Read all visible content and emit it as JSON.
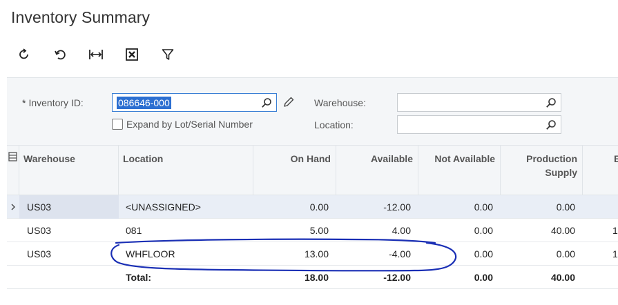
{
  "page": {
    "title": "Inventory Summary"
  },
  "toolbar": {
    "buttons": [
      {
        "name": "refresh-button",
        "icon": "refresh-icon"
      },
      {
        "name": "undo-button",
        "icon": "undo-icon"
      },
      {
        "name": "fit-to-screen-button",
        "icon": "fit-width-icon"
      },
      {
        "name": "export-excel-button",
        "icon": "excel-icon"
      },
      {
        "name": "filter-button",
        "icon": "filter-icon"
      }
    ]
  },
  "form": {
    "inventory_id": {
      "label": "Inventory ID:",
      "required_mark": "*",
      "value": "086646-000"
    },
    "expand_lot": {
      "label": "Expand by Lot/Serial Number",
      "checked": false
    },
    "warehouse": {
      "label": "Warehouse:",
      "value": ""
    },
    "location": {
      "label": "Location:",
      "value": ""
    }
  },
  "grid": {
    "columns": [
      "Warehouse",
      "Location",
      "On Hand",
      "Available",
      "Not Available",
      "Production Supply",
      "E"
    ],
    "rows": [
      {
        "warehouse": "US03",
        "location": "<UNASSIGNED>",
        "on_hand": "0.00",
        "available": "-12.00",
        "not_available": "0.00",
        "production_supply": "0.00",
        "extra": ""
      },
      {
        "warehouse": "US03",
        "location": "081",
        "on_hand": "5.00",
        "available": "4.00",
        "not_available": "0.00",
        "production_supply": "40.00",
        "extra": "1"
      },
      {
        "warehouse": "US03",
        "location": "WHFLOOR",
        "on_hand": "13.00",
        "available": "-4.00",
        "not_available": "0.00",
        "production_supply": "0.00",
        "extra": "1"
      }
    ],
    "total": {
      "label": "Total:",
      "on_hand": "18.00",
      "available": "-12.00",
      "not_available": "0.00",
      "production_supply": "40.00"
    }
  },
  "colors": {
    "accent": "#2c6fd1",
    "annotation": "#1a2fb5",
    "header_bg": "#f4f6f8"
  }
}
